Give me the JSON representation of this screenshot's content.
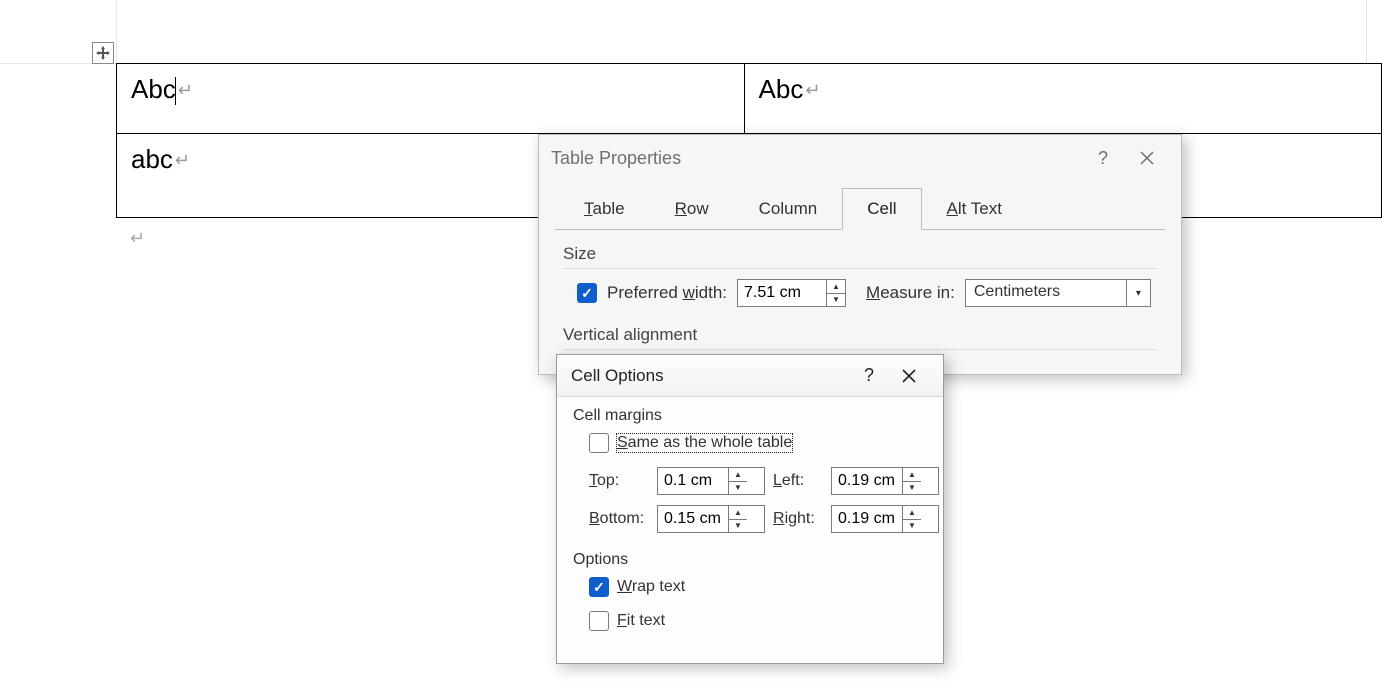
{
  "document": {
    "cells": {
      "r1c1": "Abc",
      "r1c2": "Abc",
      "r2c1": "abc"
    }
  },
  "tableProperties": {
    "title": "Table Properties",
    "tabs": {
      "table": "Table",
      "row": "Row",
      "column": "Column",
      "cell": "Cell",
      "altText": "Alt Text"
    },
    "size": {
      "section": "Size",
      "preferredWidthLabel": "Preferred width:",
      "preferredWidth": "7.51 cm",
      "measureInLabel": "Measure in:",
      "measureIn": "Centimeters"
    },
    "verticalAlignment": {
      "section": "Vertical alignment"
    }
  },
  "cellOptions": {
    "title": "Cell Options",
    "cellMargins": {
      "section": "Cell margins",
      "sameAsTableLabel": "Same as the whole table",
      "topLabel": "Top:",
      "top": "0.1 cm",
      "bottomLabel": "Bottom:",
      "bottom": "0.15 cm",
      "leftLabel": "Left:",
      "left": "0.19 cm",
      "rightLabel": "Right:",
      "right": "0.19 cm"
    },
    "options": {
      "section": "Options",
      "wrapTextLabel": "Wrap text",
      "fitTextLabel": "Fit text"
    }
  }
}
